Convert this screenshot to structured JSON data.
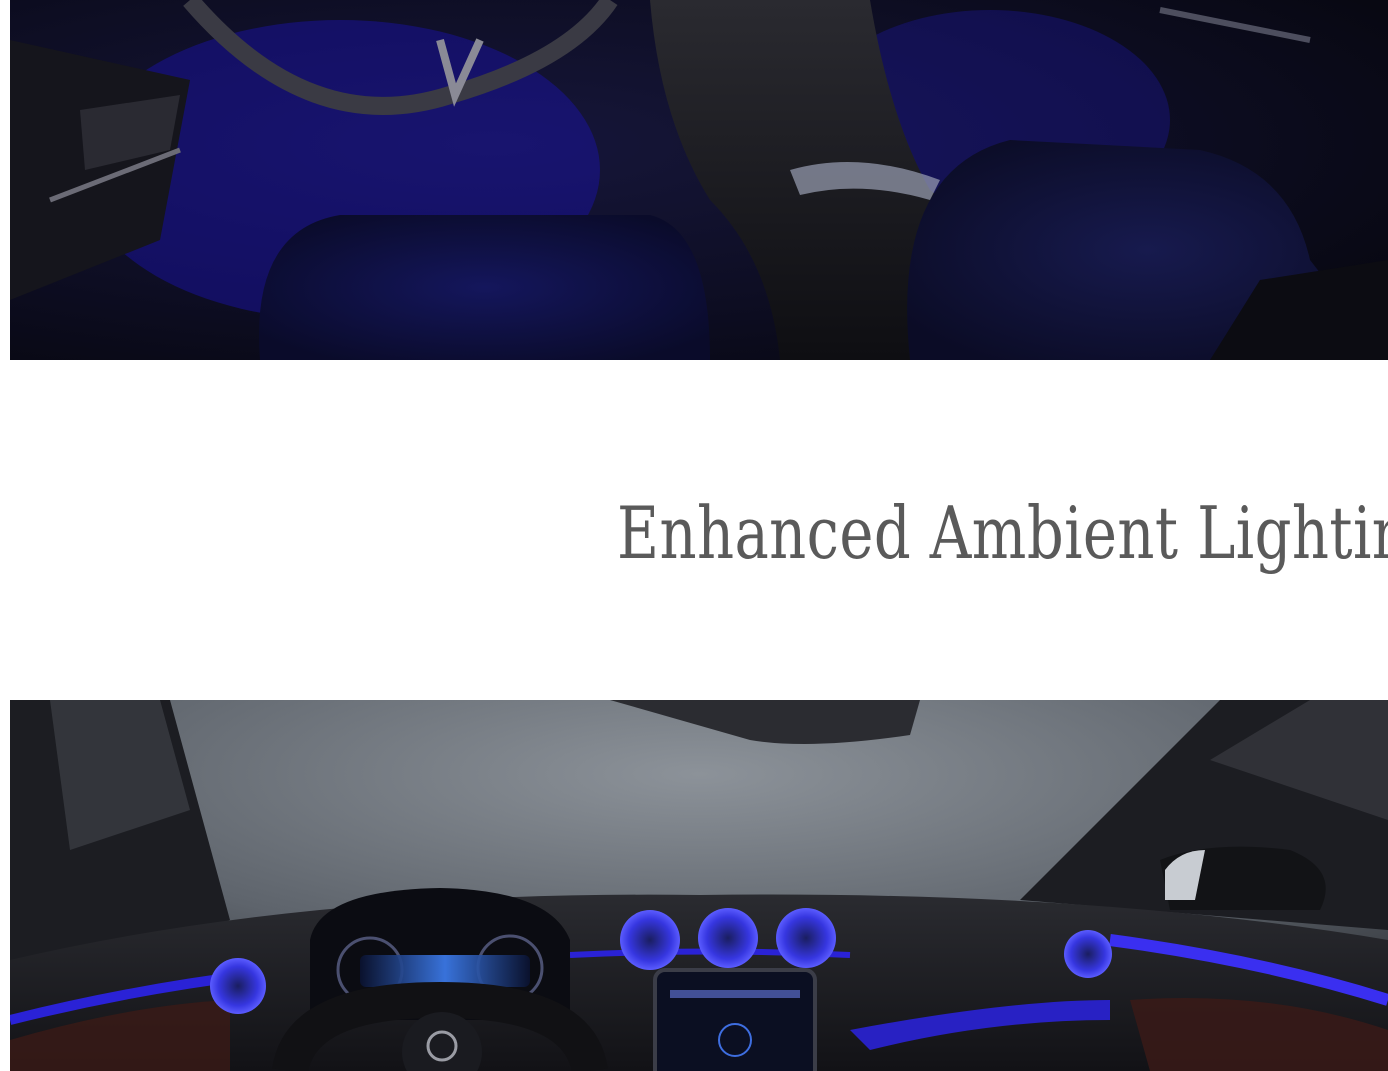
{
  "section": {
    "heading": "Enhanced Ambient Lighting"
  },
  "images": {
    "top": {
      "icon": "car-interior-rear-seats-photo"
    },
    "bottom": {
      "icon": "car-dashboard-ambient-lighting-photo"
    }
  },
  "colors": {
    "heading_text": "#5a5a5a",
    "ambient_blue": "#2a22d6",
    "interior_dark": "#0b0b14"
  }
}
